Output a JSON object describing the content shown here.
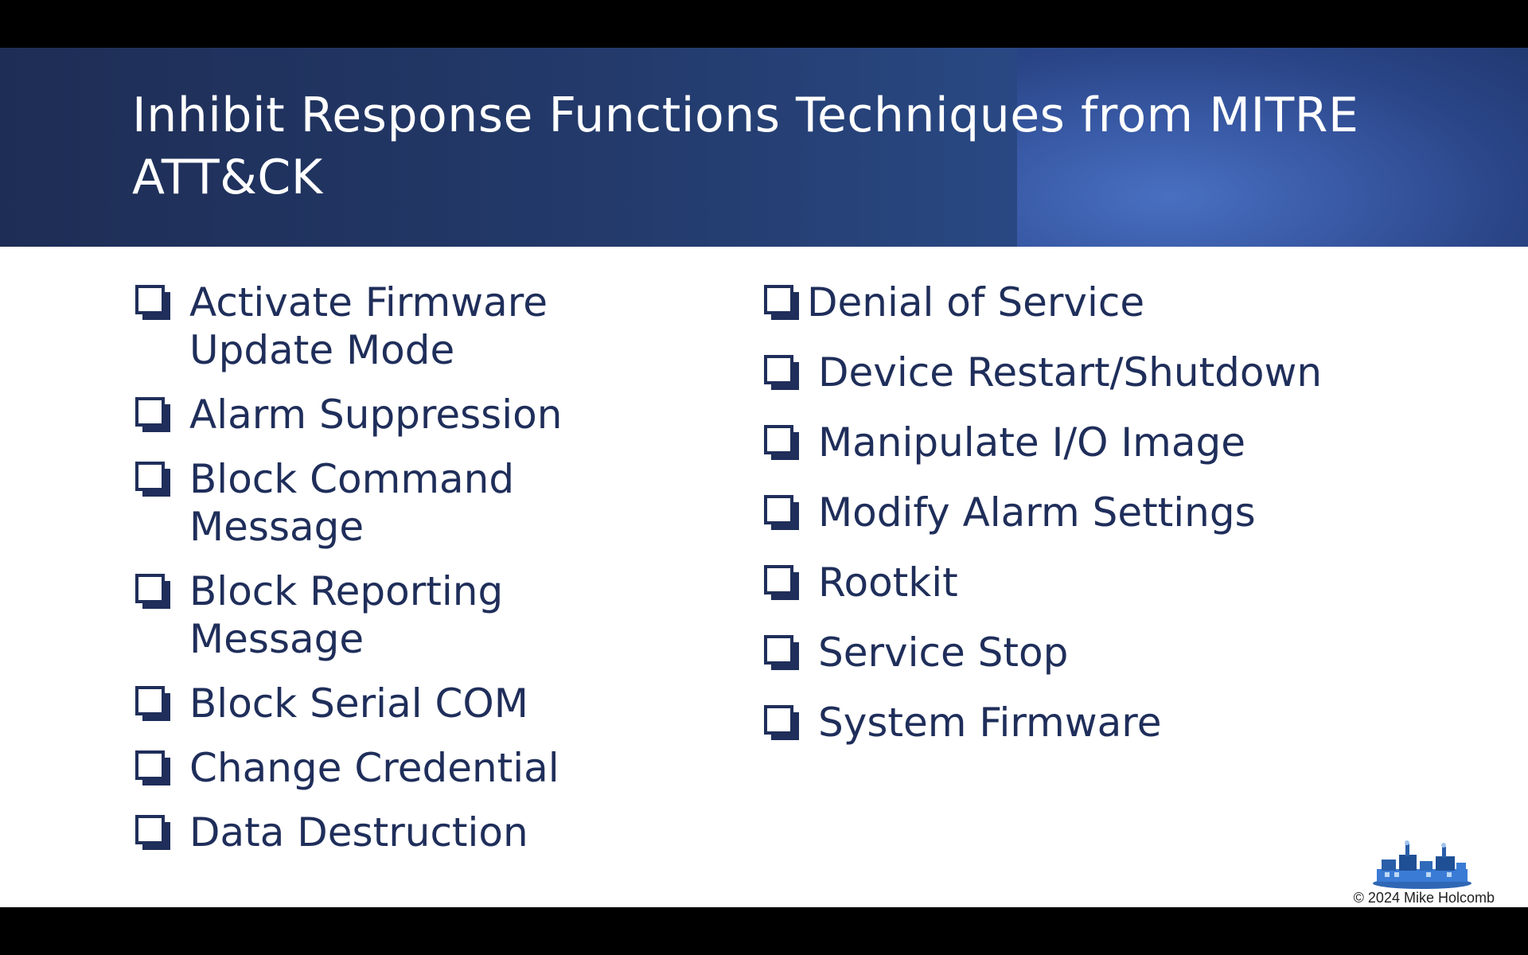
{
  "slide": {
    "title": "Inhibit Response Functions Techniques from MITRE ATT&CK",
    "left_items": [
      {
        "label": "Activate Firmware Update Mode",
        "icon": "checkbox-icon"
      },
      {
        "label": "Alarm Suppression",
        "icon": "checkbox-icon"
      },
      {
        "label": "Block Command Message",
        "icon": "checkbox-icon"
      },
      {
        "label": "Block Reporting Message",
        "icon": "checkbox-icon"
      },
      {
        "label": "Block Serial COM",
        "icon": "checkbox-icon"
      },
      {
        "label": "Change Credential",
        "icon": "checkbox-icon"
      },
      {
        "label": "Data Destruction",
        "icon": "checkbox-icon"
      }
    ],
    "right_items": [
      {
        "label": "Denial of Service",
        "icon": "checkbox-icon"
      },
      {
        "label": "Device Restart/Shutdown",
        "icon": "checkbox-icon"
      },
      {
        "label": "Manipulate I/O Image",
        "icon": "checkbox-icon"
      },
      {
        "label": "Modify Alarm Settings",
        "icon": "checkbox-icon"
      },
      {
        "label": "Rootkit",
        "icon": "checkbox-icon"
      },
      {
        "label": "Service Stop",
        "icon": "checkbox-icon"
      },
      {
        "label": "System Firmware",
        "icon": "checkbox-icon"
      }
    ],
    "footer": {
      "copyright": "© 2024 Mike Holcomb",
      "logo_icon": "industrial-plant-logo-icon"
    }
  },
  "colors": {
    "banner": "#223a6e",
    "banner_highlight": "#4a72c4",
    "title_text": "#ffffff",
    "body_text": "#1f2e5a",
    "background": "#ffffff",
    "letterbox": "#000000"
  }
}
